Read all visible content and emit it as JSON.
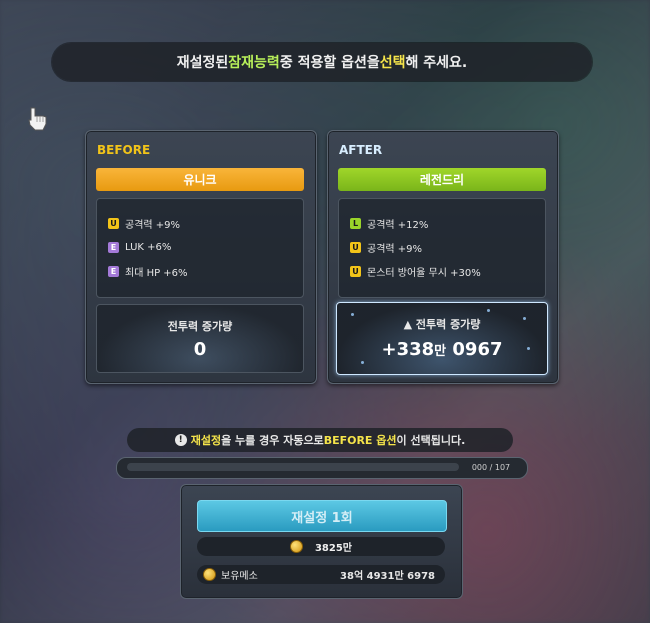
{
  "notice": {
    "part1": "재설정된 ",
    "highlight1": "잠재능력",
    "part2": " 중 적용할 옵션을 ",
    "highlight2": "선택",
    "part3": "해 주세요."
  },
  "before": {
    "heading": "BEFORE",
    "grade": "유니크",
    "grade_color": "#f2c419",
    "options": [
      {
        "badge": "U",
        "text": "공격력 +9%"
      },
      {
        "badge": "E",
        "text": "LUK +6%"
      },
      {
        "badge": "E",
        "text": "최대 HP +6%"
      }
    ],
    "cp_title": "전투력 증가량",
    "cp_value": "0"
  },
  "after": {
    "heading": "AFTER",
    "grade": "레전드리",
    "grade_color": "#9ad42a",
    "options": [
      {
        "badge": "L",
        "text": "공격력 +12%"
      },
      {
        "badge": "U",
        "text": "공격력 +9%"
      },
      {
        "badge": "U",
        "text": "몬스터 방어율 무시 +30%"
      }
    ],
    "cp_title": "전투력 증가량",
    "cp_value_a": "+338",
    "cp_value_unit": "만",
    "cp_value_b": " 0967"
  },
  "warning": {
    "icon": "!",
    "hl1": "재설정",
    "part1": "을 누를 경우 자동으로 ",
    "hl2": "BEFORE 옵션",
    "part2": "이 선택됩니다."
  },
  "progress": {
    "count": "000 / 107",
    "fraction": 0
  },
  "action": {
    "reset_label": "재설정 1회",
    "cost": "3825만",
    "held_label": "보유메소",
    "held_value": "38억 4931만 6978"
  }
}
